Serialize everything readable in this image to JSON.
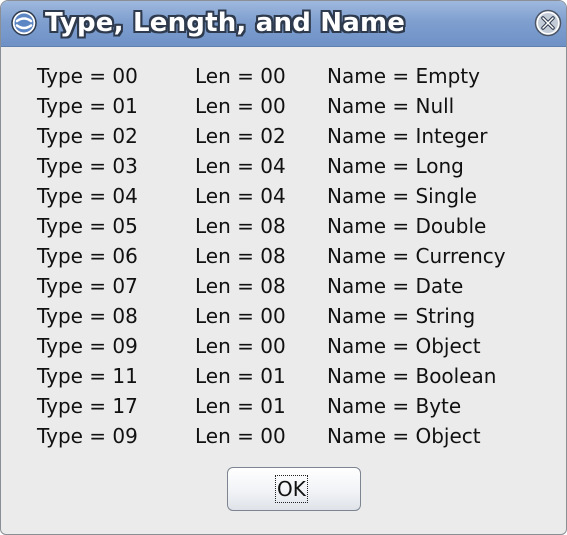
{
  "window": {
    "title": "Type, Length, and Name",
    "close_icon": "close-x-circle-icon",
    "app_icon": "vb-swirl-icon"
  },
  "rows": [
    {
      "type": "Type = 00",
      "len": "Len = 00",
      "name": "Name = Empty"
    },
    {
      "type": "Type = 01",
      "len": "Len = 00",
      "name": "Name = Null"
    },
    {
      "type": "Type = 02",
      "len": "Len = 02",
      "name": "Name = Integer"
    },
    {
      "type": "Type = 03",
      "len": "Len = 04",
      "name": "Name = Long"
    },
    {
      "type": "Type = 04",
      "len": "Len = 04",
      "name": "Name = Single"
    },
    {
      "type": "Type = 05",
      "len": "Len = 08",
      "name": "Name = Double"
    },
    {
      "type": "Type = 06",
      "len": "Len = 08",
      "name": "Name = Currency"
    },
    {
      "type": "Type = 07",
      "len": "Len = 08",
      "name": "Name = Date"
    },
    {
      "type": "Type = 08",
      "len": "Len = 00",
      "name": "Name = String"
    },
    {
      "type": "Type = 09",
      "len": "Len = 00",
      "name": "Name = Object"
    },
    {
      "type": "Type = 11",
      "len": "Len = 01",
      "name": "Name = Boolean"
    },
    {
      "type": "Type = 17",
      "len": "Len = 01",
      "name": "Name = Byte"
    },
    {
      "type": "Type = 09",
      "len": "Len = 00",
      "name": "Name = Object"
    }
  ],
  "buttons": {
    "ok_label": "OK"
  },
  "colors": {
    "titlebar": "#7f9fcf",
    "dialog_bg": "#ebebeb",
    "title_text": "#ffffff",
    "title_outline": "#2e3a4d"
  }
}
